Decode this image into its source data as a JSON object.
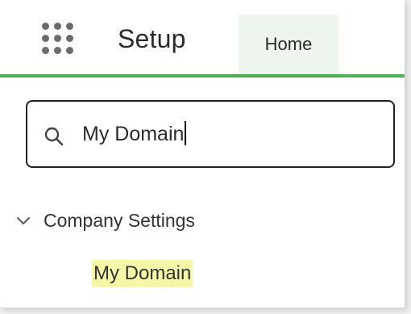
{
  "header": {
    "app_launcher_icon": "grid-dots-icon",
    "title": "Setup",
    "tabs": [
      {
        "label": "Home",
        "selected": true
      }
    ],
    "accent_color": "#4caf50"
  },
  "search": {
    "icon": "search-icon",
    "value": "My Domain"
  },
  "tree": {
    "sections": [
      {
        "label": "Company Settings",
        "expanded": true,
        "items": [
          {
            "label": "My Domain",
            "highlighted": true
          }
        ]
      }
    ]
  },
  "colors": {
    "highlight": "#f7f7a8",
    "tab_background": "#eef4ee"
  }
}
